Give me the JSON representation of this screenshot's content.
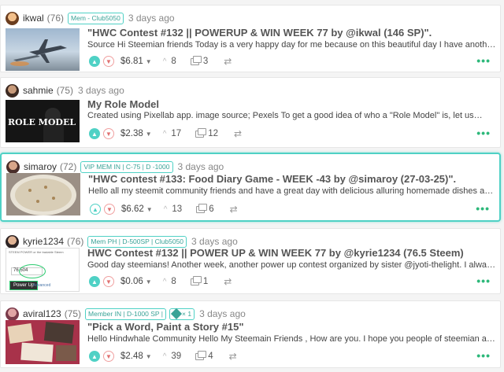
{
  "posts": [
    {
      "author": "ikwal",
      "rep": "(76)",
      "badges": [
        "Mem - Club5050"
      ],
      "time": "3 days ago",
      "title": "\"HWC Contest #132 || POWERUP & WIN WEEK 77 by @ikwal (146 SP)\".",
      "body": "Source Hi Steemian friends Today is a very happy day for me because on this beautiful day I have another…",
      "payout": "$6.81",
      "votes": "8",
      "comments": "3",
      "thumb_icon": "jet-thumbnail"
    },
    {
      "author": "sahmie",
      "rep": "(75)",
      "badges": [],
      "time": "3 days ago",
      "title": "My Role Model",
      "body": "Created using Pixellab app. image source; Pexels To get a good idea of who a \"Role Model\" is, let us…",
      "payout": "$2.38",
      "votes": "17",
      "comments": "12",
      "thumb_text": "ROLE MODEL"
    },
    {
      "author": "simaroy",
      "rep": "(72)",
      "badges": [
        "VIP MEM IN | C-75 | D -1000"
      ],
      "time": "3 days ago",
      "title": "\"HWC contest #133: Food Diary Game - WEEK -43 by @simaroy (27-03-25)\".",
      "body": "Hello all my steemit community friends and have a great day with delicious alluring homemade dishes and today i am…",
      "payout": "$6.62",
      "votes": "13",
      "comments": "6",
      "thumb_icon": "food-thumbnail"
    },
    {
      "author": "kyrie1234",
      "rep": "(76)",
      "badges": [
        "Mem PH | D-500SP | Club5050"
      ],
      "time": "3 days ago",
      "title": "HWC Contest #132 || POWER UP & WIN WEEK 77 by @kyrie1234 (76.5 Steem)",
      "body": "Good day steemians! Another week, another power up contest organized by sister @jyoti-thelight. I always feel so…",
      "payout": "$0.06",
      "votes": "8",
      "comments": "1",
      "thumb_lines": [
        "STEEM POWER or the tradable Steem",
        "Power Up",
        "76.504",
        "Advanced"
      ]
    },
    {
      "author": "aviral123",
      "rep": "(75)",
      "badges": [
        "Member IN | D-1000 SP |"
      ],
      "chip": "× 1",
      "time": "3 days ago",
      "title": "\"Pick a Word, Paint a Story #15\"",
      "body": "Hello Hindwhale Community Hello My Steemain Friends , How are you. I hope you people of steemian are good…",
      "payout": "$2.48",
      "votes": "39",
      "comments": "4",
      "thumb_icon": "collage-thumbnail"
    }
  ],
  "colors": {
    "accent": "#4fd1c5",
    "downvote": "#e07070",
    "more": "#2db87a"
  }
}
